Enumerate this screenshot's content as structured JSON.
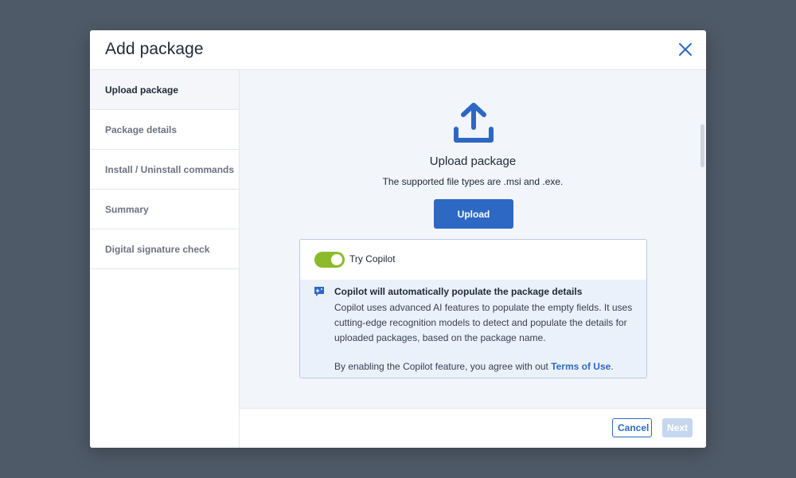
{
  "modal": {
    "title": "Add package"
  },
  "steps": [
    {
      "label": "Upload package",
      "active": true
    },
    {
      "label": "Package details",
      "active": false
    },
    {
      "label": "Install / Uninstall commands",
      "active": false
    },
    {
      "label": "Summary",
      "active": false
    },
    {
      "label": "Digital signature check",
      "active": false
    }
  ],
  "upload": {
    "icon": "upload-icon",
    "title": "Upload package",
    "subtitle": "The supported file types are .msi and .exe.",
    "button_label": "Upload"
  },
  "copilot": {
    "toggle_on": true,
    "toggle_label": "Try Copilot",
    "info_title": "Copilot will automatically populate the package details",
    "info_body": "Copilot uses advanced AI features to populate the empty fields. It uses cutting-edge recognition models to detect and populate the details for uploaded packages, based on the package name.",
    "agree_text": "By enabling the Copilot feature, you agree with out ",
    "terms_link": "Terms of Use",
    "agree_suffix": "."
  },
  "footer": {
    "cancel_label": "Cancel",
    "next_label": "Next"
  },
  "colors": {
    "accent": "#2d68c4",
    "toggle_on": "#8bbb2a",
    "backdrop": "#4f5a68"
  }
}
